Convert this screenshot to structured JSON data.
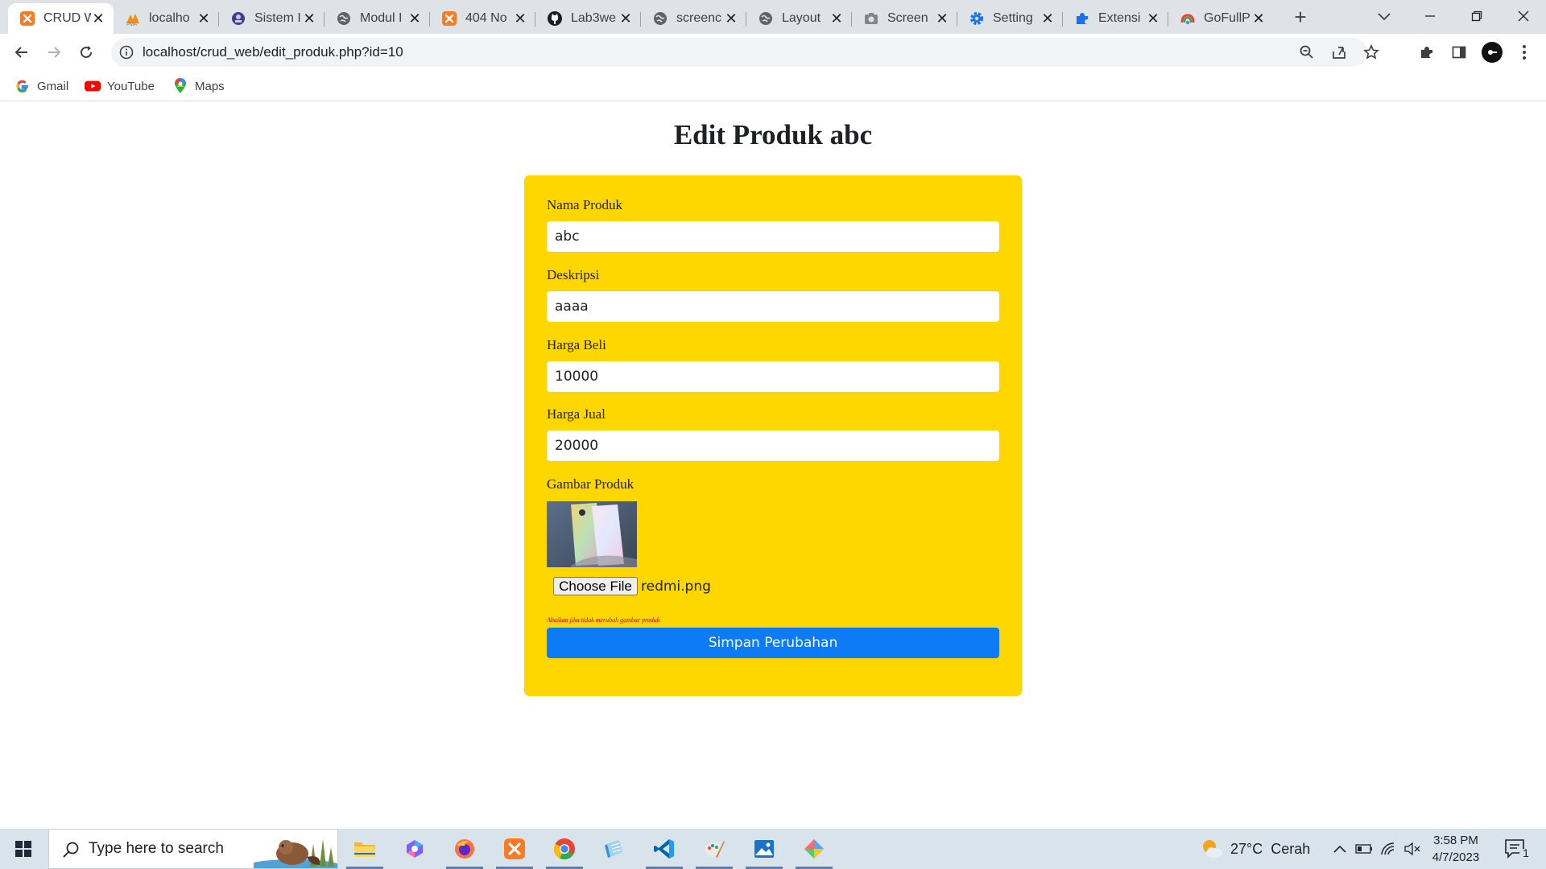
{
  "browser": {
    "tabs": [
      {
        "title": "CRUD W",
        "icon": "xampp-icon",
        "active": true
      },
      {
        "title": "localho",
        "icon": "phpmyadmin-icon",
        "active": false
      },
      {
        "title": "Sistem I",
        "icon": "university-icon",
        "active": false
      },
      {
        "title": "Modul I",
        "icon": "globe-icon",
        "active": false
      },
      {
        "title": "404 No",
        "icon": "xampp-icon",
        "active": false
      },
      {
        "title": "Lab3we",
        "icon": "github-icon",
        "active": false
      },
      {
        "title": "screenc",
        "icon": "globe-icon",
        "active": false
      },
      {
        "title": "Layout",
        "icon": "globe-icon",
        "active": false
      },
      {
        "title": "Screen",
        "icon": "camera-icon",
        "active": false
      },
      {
        "title": "Setting",
        "icon": "settings-gear-icon",
        "active": false
      },
      {
        "title": "Extensi",
        "icon": "puzzle-icon",
        "active": false
      },
      {
        "title": "GoFullP",
        "icon": "gofullpage-icon",
        "active": false
      }
    ],
    "url": "localhost/crud_web/edit_produk.php?id=10",
    "bookmarks": [
      {
        "label": "Gmail",
        "icon": "google-icon"
      },
      {
        "label": "YouTube",
        "icon": "youtube-icon"
      },
      {
        "label": "Maps",
        "icon": "maps-pin-icon"
      }
    ]
  },
  "page": {
    "title": "Edit Produk abc",
    "form": {
      "nama": {
        "label": "Nama Produk",
        "value": "abc"
      },
      "deskripsi": {
        "label": "Deskripsi",
        "value": "aaaa"
      },
      "harga_beli": {
        "label": "Harga Beli",
        "value": "10000"
      },
      "harga_jual": {
        "label": "Harga Jual",
        "value": "20000"
      },
      "gambar": {
        "label": "Gambar Produk",
        "button": "Choose File",
        "file_name": "redmi.png"
      },
      "hint": "Abaikan jika tidak merubah gambar produk",
      "submit": "Simpan Perubahan"
    }
  },
  "taskbar": {
    "search_placeholder": "Type here to search",
    "apps": [
      "file-explorer-icon",
      "copilot-icon",
      "firefox-icon",
      "xampp-icon",
      "chrome-icon",
      "notepad-icon",
      "vscode-icon",
      "paint-icon",
      "photos-icon",
      "git-icon"
    ],
    "weather": {
      "temp": "27°C",
      "condition": "Cerah"
    },
    "time": "3:58 PM",
    "date": "4/7/2023",
    "notification_count": "1"
  },
  "colors": {
    "form_background": "#ffd700",
    "submit_button": "#0d7bf4",
    "hint_text": "#d40000",
    "tabstrip": "#dfe3e7",
    "taskbar": "#d9e3ec"
  }
}
